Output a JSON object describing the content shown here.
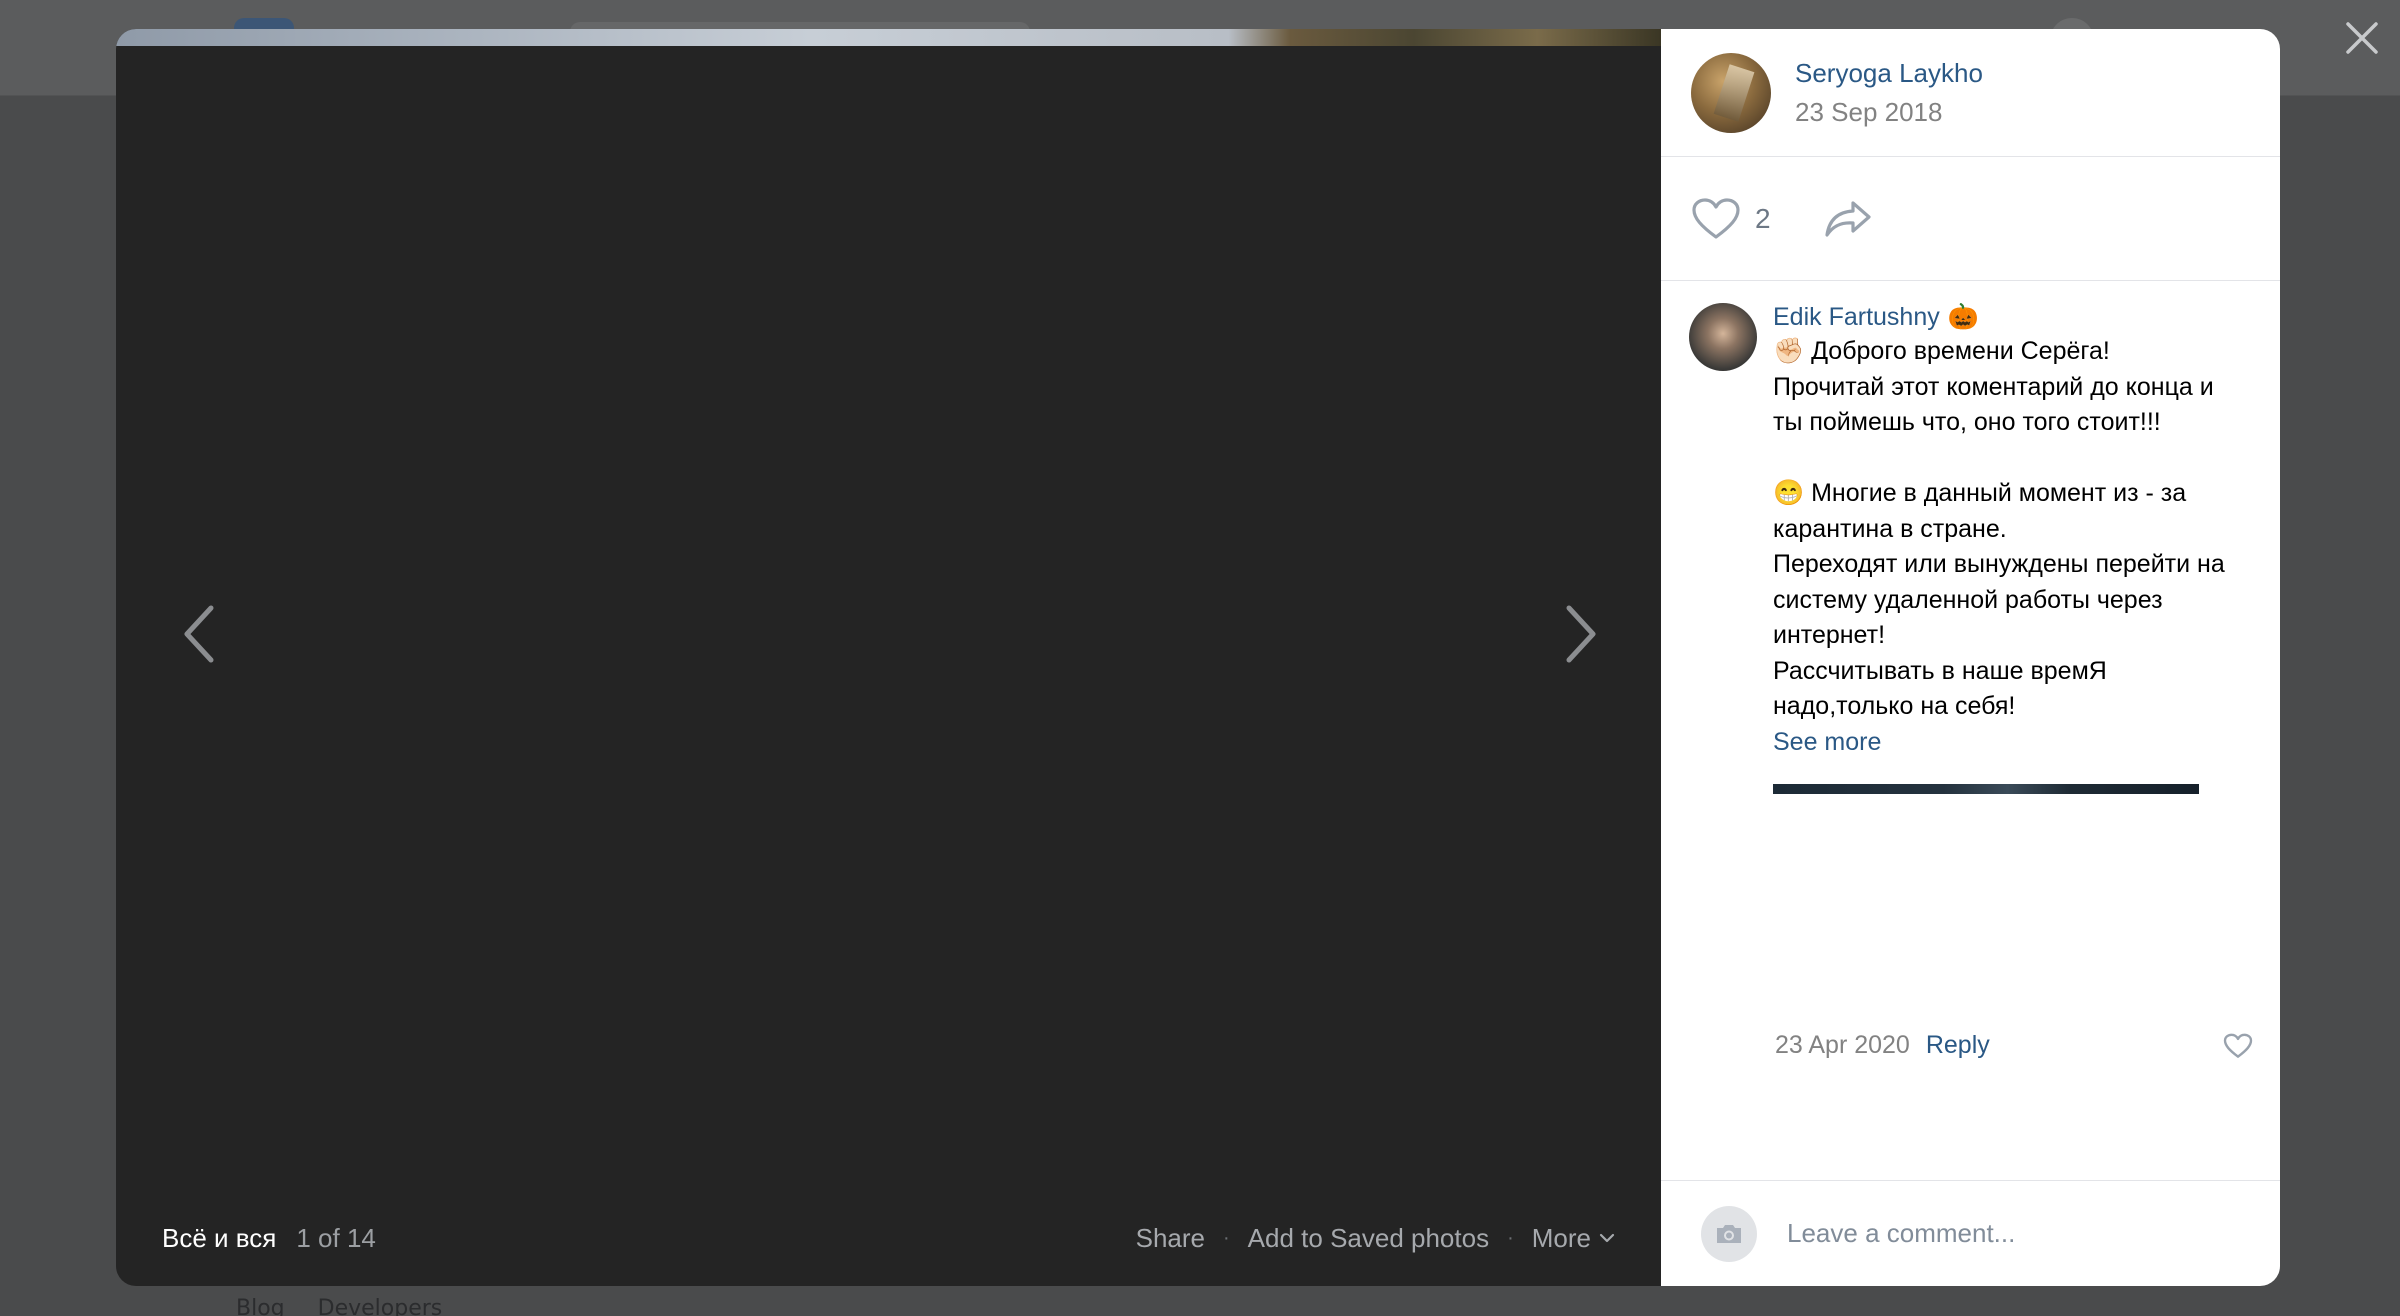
{
  "background": {
    "footer_links": [
      "Blog",
      "Developers"
    ]
  },
  "viewer": {
    "album_title": "Всё и вся",
    "counter": "1 of 14",
    "actions": {
      "share": "Share",
      "save": "Add to Saved photos",
      "more": "More"
    },
    "icons": {
      "close": "close-icon",
      "prev": "chevron-left-icon",
      "next": "chevron-right-icon"
    }
  },
  "post": {
    "author_name": "Seryoga Laykho",
    "date": "23 Sep 2018",
    "like_count": "2"
  },
  "comments": [
    {
      "author": "Edik Fartushny",
      "author_emoji": "🎃",
      "text": "✊🏻 Доброго времени Серёга!\nПрочитай этот коментарий до конца и ты поймешь что, оно того стоит!!!\n\n😁 Многие в данный момент из - за карантина в стране.\nПереходят или вынуждены перейти на систему удаленной работы через интернет!\nРассчитывать в наше времЯ надо,только на себя!",
      "see_more": "See more",
      "date": "23 Apr 2020",
      "reply": "Reply"
    }
  ],
  "composer": {
    "placeholder": "Leave a comment..."
  },
  "colors": {
    "link": "#2a5885",
    "photo_bg": "#242424",
    "overlay": "#4a4b4c"
  }
}
